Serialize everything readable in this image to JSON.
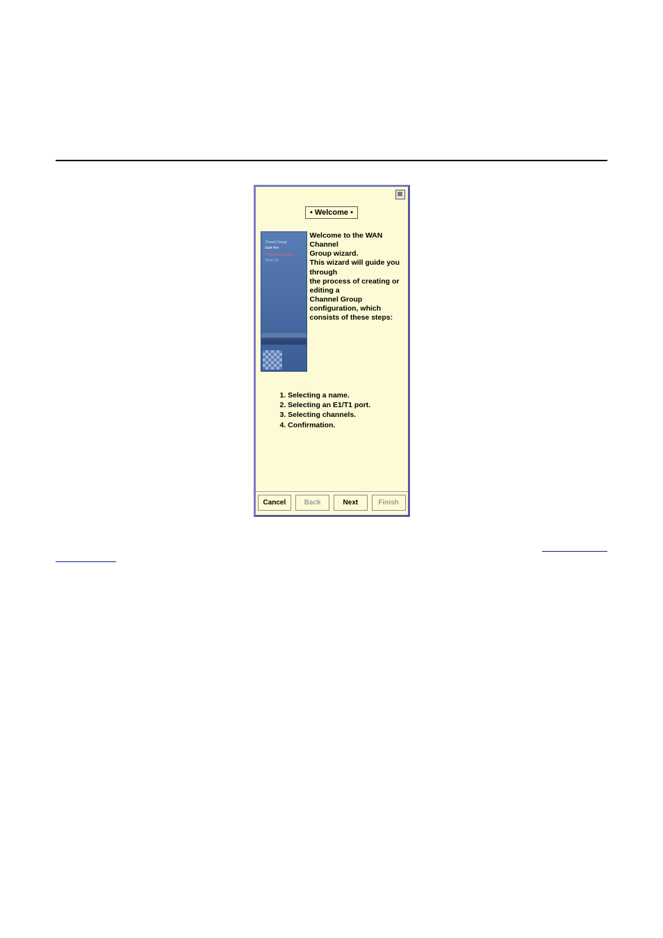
{
  "wizard": {
    "title_tab": "• Welcome •",
    "close_glyph": "⊠",
    "intro_line1": "Welcome to the WAN Channel",
    "intro_line2": "Group wizard.",
    "intro_line3": "This wizard will guide you through",
    "intro_line4": "the process of creating or editing a",
    "intro_line5": "Channel Group configuration, which",
    "intro_line6": "consists of these steps:",
    "steps": {
      "s1": "1. Selecting a name.",
      "s2": "2. Selecting an E1/T1 port.",
      "s3": "3. Selecting channels.",
      "s4": "4. Confirmation."
    },
    "buttons": {
      "cancel": "Cancel",
      "back": "Back",
      "next": "Next",
      "finish": "Finish"
    },
    "side_labels": {
      "a": "Chanel Group",
      "b": "East 4ns",
      "c": "Chanel Group You",
      "d": "West 2fn"
    }
  },
  "page_links": {
    "left": "",
    "right": ""
  }
}
